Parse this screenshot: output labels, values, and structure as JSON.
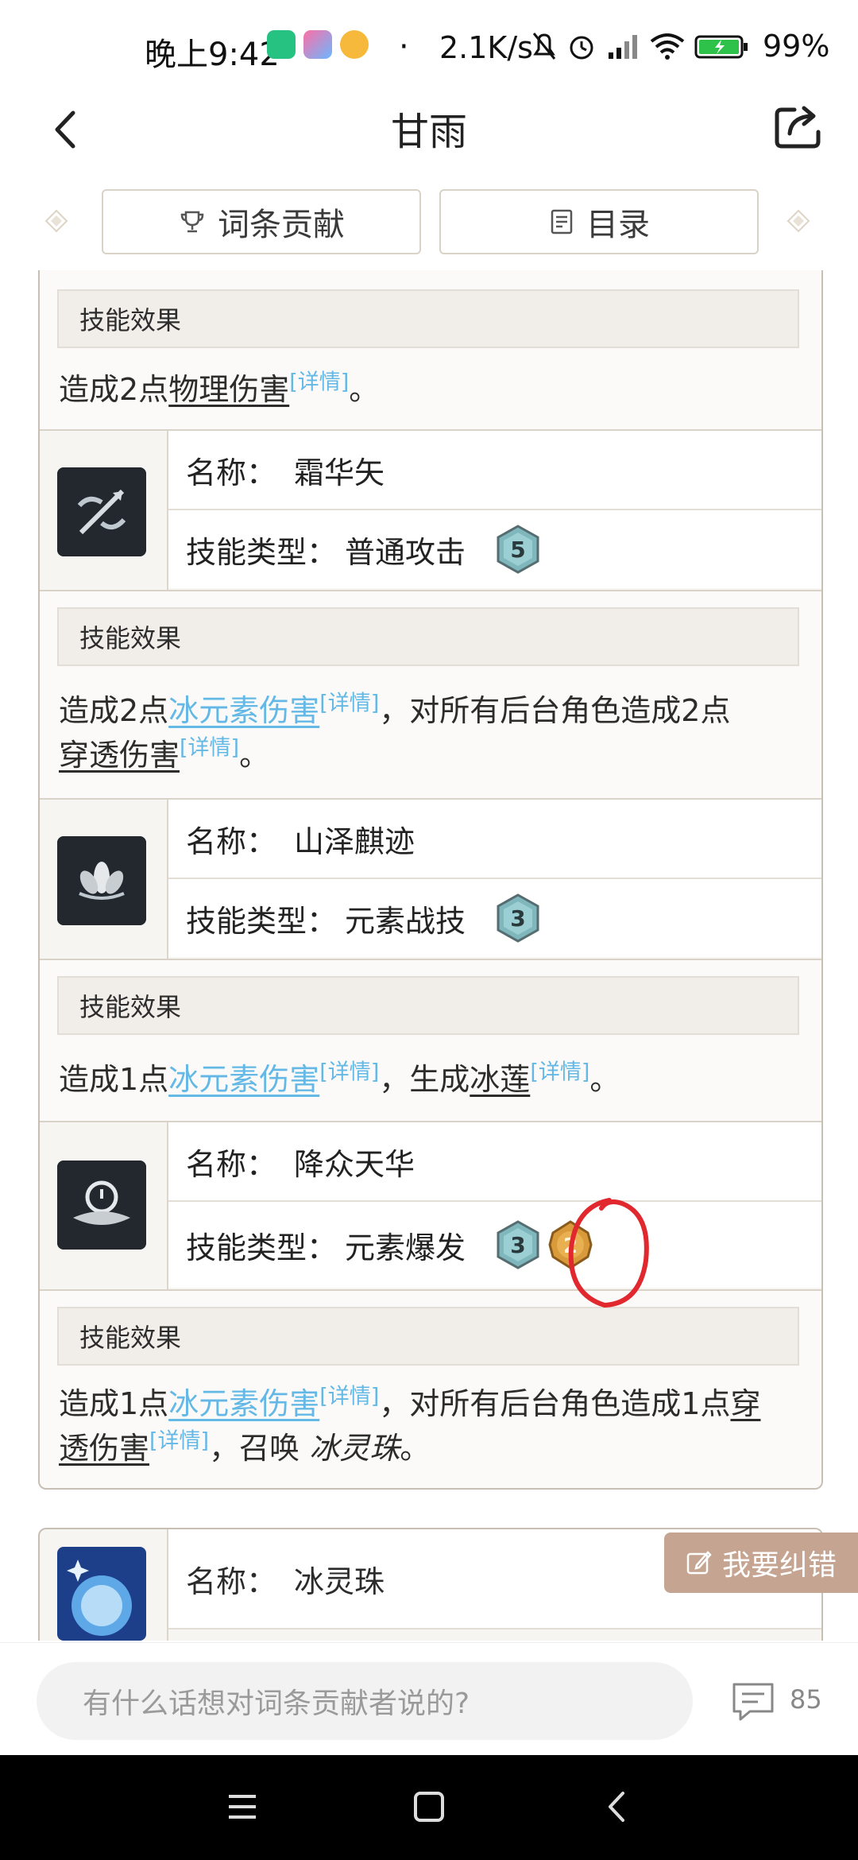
{
  "status_bar": {
    "time": "晚上9:42",
    "dot": "·",
    "net_speed": "2.1K/s",
    "battery": "99%"
  },
  "header": {
    "title": "甘雨"
  },
  "tabs": [
    {
      "label": "词条贡献",
      "icon": "trophy-icon"
    },
    {
      "label": "目录",
      "icon": "list-icon"
    }
  ],
  "card": {
    "effect_label": "技能效果",
    "blocks": [
      {
        "effect_parts": [
          {
            "t": "造成2点"
          },
          {
            "u": "物理伤害"
          },
          {
            "d": "[详情]"
          },
          {
            "t": "。"
          }
        ]
      }
    ],
    "skills": [
      {
        "name_label": "名称：",
        "name": "霜华矢",
        "type_label": "技能类型：",
        "type": "普通攻击",
        "costs": [
          "5"
        ],
        "icon": "frost-arrow-icon",
        "effect_line1": {
          "p1": "造成2点",
          "blue": "冰元素伤害",
          "detail1": "[详情]",
          "p2": "，对所有后台角色造成2点"
        },
        "effect_line2": {
          "u": "穿透伤害",
          "detail": "[详情]",
          "end": "。"
        }
      },
      {
        "name_label": "名称：",
        "name": "山泽麒迹",
        "type_label": "技能类型：",
        "type": "元素战技",
        "costs": [
          "3"
        ],
        "icon": "lotus-icon",
        "effect_line1": {
          "p1": "造成1点",
          "blue": "冰元素伤害",
          "detail1": "[详情]",
          "p2": "，生成",
          "u": "冰莲",
          "detail2": "[详情]",
          "end": "。"
        }
      },
      {
        "name_label": "名称：",
        "name": "降众天华",
        "type_label": "技能类型：",
        "type": "元素爆发",
        "costs": [
          "3",
          "2"
        ],
        "icon": "celestial-icon",
        "effect_line1": {
          "p1": "造成1点",
          "blue": "冰元素伤害",
          "detail1": "[详情]",
          "p2": "，对所有后台角色造成1点",
          "u1": "穿"
        },
        "effect_line2": {
          "u": "透伤害",
          "detail": "[详情]",
          "p": "，召唤 ",
          "i": "冰灵珠",
          "end": "。"
        }
      }
    ]
  },
  "card2": {
    "name_label": "名称：",
    "name": "冰灵珠",
    "icon": "ice-orb-icon"
  },
  "fix_button": {
    "label": "我要纠错"
  },
  "comment_bar": {
    "placeholder": "有什么话想对词条贡献者说的?",
    "count": "85"
  },
  "colors": {
    "link_blue": "#63b8e6",
    "fix_button": "#c5a591",
    "annotation_red": "#e0282e"
  }
}
